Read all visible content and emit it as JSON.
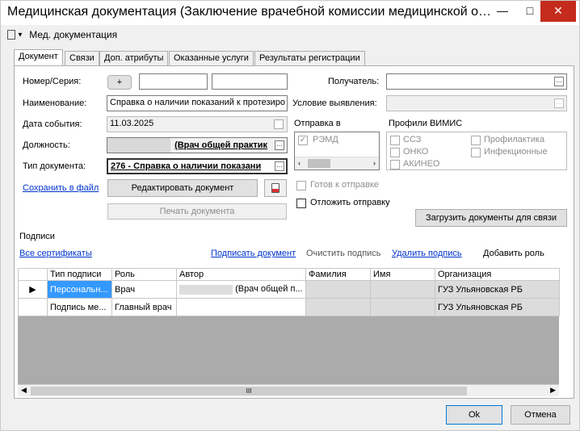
{
  "window": {
    "title": "Медицинская документация (Заключение врачебной комиссии медицинской организации",
    "minimize": "—",
    "maximize": "□",
    "close": "✕"
  },
  "toolbar": {
    "menu_label": "Мед. документация"
  },
  "tabs": [
    "Документ",
    "Связи",
    "Доп. атрибуты",
    "Оказанные услуги",
    "Результаты регистрации"
  ],
  "form": {
    "number_label": "Номер/Серия:",
    "plus_button": "+",
    "name_label": "Наименование:",
    "name_value": "Справка о наличии показаний к протезиро",
    "event_date_label": "Дата события:",
    "event_date_value": "11.03.2025",
    "position_label": "Должность:",
    "position_value": "(Врач общей практик",
    "doc_type_label": "Тип документа:",
    "doc_type_value": "276 - Справка о наличии показани",
    "save_link": "Сохранить в файл",
    "edit_button": "Редактировать документ",
    "print_button": "Печать документа",
    "recipient_label": "Получатель:",
    "condition_label": "Условие выявления:",
    "send_label": "Отправка в",
    "send_option": "РЭМД",
    "vimis_label": "Профили ВИМИС",
    "vimis": [
      "ССЗ",
      "ОНКО",
      "АКИНЕО",
      "Профилактика",
      "Инфекционные"
    ],
    "ready_label": "Готов к отправке",
    "postpone_label": "Отложить отправку",
    "upload_button": "Загрузить документы для связи"
  },
  "signatures": {
    "group_label": "Подписи",
    "all_certs": "Все сертификаты",
    "sign": "Подписать документ",
    "clear": "Очистить подпись",
    "delete": "Удалить подпись",
    "add_role": "Добавить роль",
    "columns": [
      "Тип подписи",
      "Роль",
      "Автор",
      "Фамилия",
      "Имя",
      "Организация"
    ],
    "rows": [
      {
        "type": "Персональн...",
        "role": "Врач",
        "author": "(Врач общей п...",
        "surname": "",
        "name": "",
        "org": "ГУЗ Ульяновская РБ"
      },
      {
        "type": "Подпись ме...",
        "role": "Главный врач",
        "author": "",
        "surname": "",
        "name": "",
        "org": "ГУЗ Ульяновская РБ"
      }
    ]
  },
  "footer": {
    "ok": "Ok",
    "cancel": "Отмена"
  }
}
